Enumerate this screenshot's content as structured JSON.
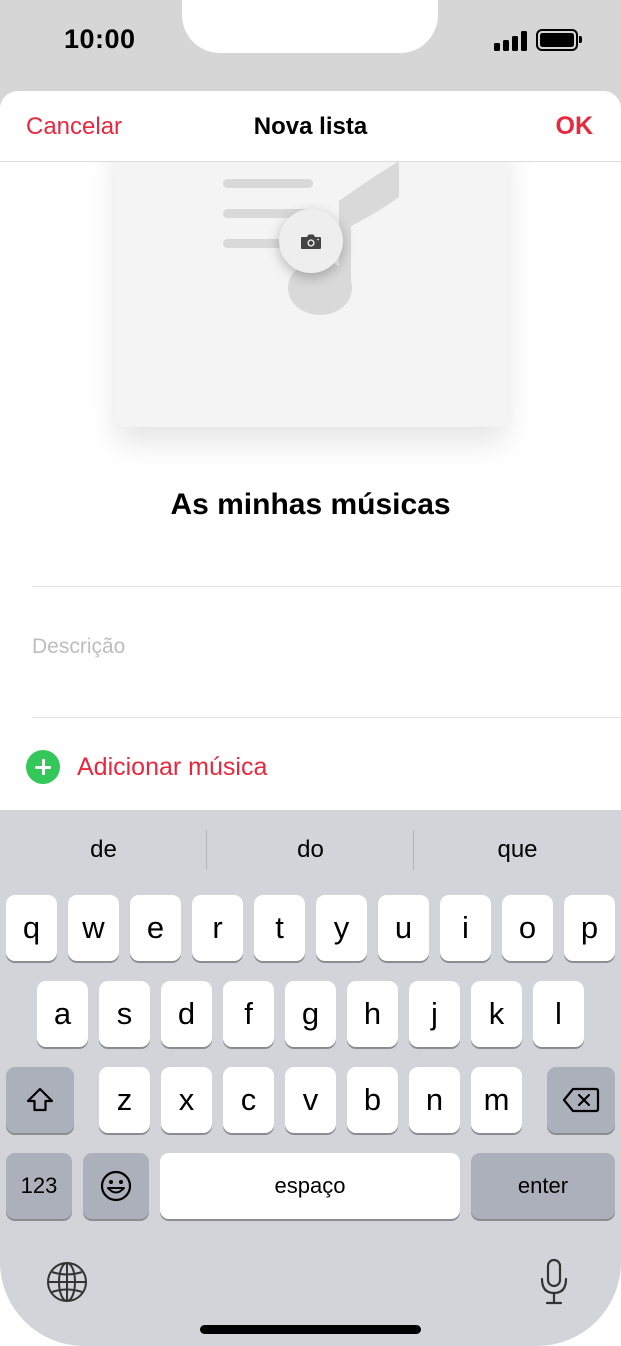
{
  "status_bar": {
    "time": "10:00"
  },
  "navbar": {
    "cancel": "Cancelar",
    "title": "Nova lista",
    "ok": "OK"
  },
  "playlist": {
    "name": "As minhas músicas",
    "description_placeholder": "Descrição",
    "add_music": "Adicionar música"
  },
  "keyboard": {
    "suggestions": [
      "de",
      "do",
      "que"
    ],
    "row1": [
      "q",
      "w",
      "e",
      "r",
      "t",
      "y",
      "u",
      "i",
      "o",
      "p"
    ],
    "row2": [
      "a",
      "s",
      "d",
      "f",
      "g",
      "h",
      "j",
      "k",
      "l"
    ],
    "row3": [
      "z",
      "x",
      "c",
      "v",
      "b",
      "n",
      "m"
    ],
    "numbers_key": "123",
    "space_key": "espaço",
    "enter_key": "enter"
  },
  "colors": {
    "accent": "#e8283d",
    "add_green": "#34c759",
    "keyboard_bg": "#d2d4da"
  },
  "icons": [
    "camera-icon",
    "add-icon",
    "shift-icon",
    "backspace-icon",
    "emoji-icon",
    "globe-icon",
    "microphone-icon",
    "music-note-icon"
  ]
}
